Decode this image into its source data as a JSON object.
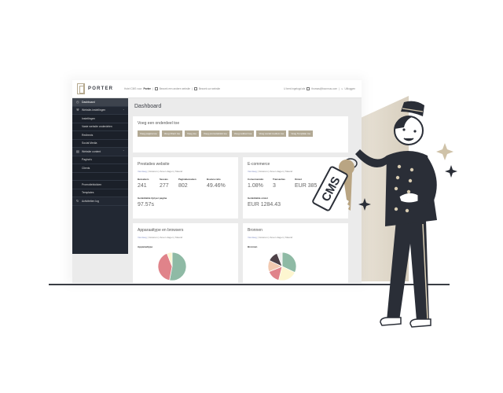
{
  "colors": {
    "accent": "#b2a994",
    "sidebar_bg": "#222833",
    "ink": "#2a2e37",
    "pie_green": "#8fbaa5",
    "pie_red": "#e0838a",
    "pie_cream": "#fdf6d0",
    "pie_dark": "#4e4148",
    "pie_peach": "#f2c9b0",
    "link_blue": "#8b96c5"
  },
  "header": {
    "logo": "PORTER",
    "intro_prefix": "Hotel CMS voor",
    "intro_brand": "Porter",
    "link_other_site": "Bezoek een andere website",
    "link_visit_site": "Bezoek uw website",
    "logged_in_as": "U bent ingelogd als",
    "user_email": "thomas@bconnus.com",
    "logout": "Uitloggen"
  },
  "sidebar": {
    "items": [
      {
        "label": "Dashboard",
        "icon": "dashboard-icon",
        "active": true
      },
      {
        "label": "Website-instellingen",
        "icon": "wrench-icon",
        "expandable": true
      },
      {
        "label": "Instellingen",
        "sub": true
      },
      {
        "label": "Vaste website onderdelen",
        "sub": true
      },
      {
        "label": "Redirects",
        "sub": true
      },
      {
        "label": "Social Media",
        "sub": true
      },
      {
        "label": "Website content",
        "icon": "content-icon",
        "expandable": true
      },
      {
        "label": "Pagina's",
        "sub": true
      },
      {
        "label": "Clients",
        "sub": true
      },
      {
        "label": "",
        "sub": true
      },
      {
        "label": "Promotieblokken",
        "sub": true
      },
      {
        "label": "Templates",
        "sub": true
      },
      {
        "label": "Activiteiten log",
        "icon": "history-icon"
      }
    ]
  },
  "dashboard": {
    "title": "Dashboard",
    "add_section": {
      "title": "Voeg een onderdeel toe",
      "buttons": [
        "Voeg pagina toe",
        "Voeg Client toe",
        "Voeg toe",
        "Voeg promotieblok toe",
        "Voeg redirect toe",
        "Voeg social medium toe",
        "Voeg Template toe"
      ]
    },
    "period_options": [
      "Vandaag",
      "Gisteren",
      "Zeven dagen",
      "Maand"
    ],
    "performance": {
      "title": "Prestaties website",
      "stats": [
        {
          "label": "Bezoekers",
          "value": "241"
        },
        {
          "label": "Sessies",
          "value": "277"
        },
        {
          "label": "Paginabezoeken",
          "value": "802"
        },
        {
          "label": "Bounce ratio",
          "value": "49.46%"
        }
      ],
      "avg_label": "Gemiddelde tijd per pagina",
      "avg_value": "97.57s"
    },
    "ecommerce": {
      "title": "E-commerce",
      "stats": [
        {
          "label": "Conversieratio",
          "value": "1.08%"
        },
        {
          "label": "Transacties",
          "value": "3"
        },
        {
          "label": "Omzet",
          "value": "EUR 385"
        }
      ],
      "avg_label": "Gemiddelde omzet",
      "avg_value": "EUR 1284.43"
    },
    "devices": {
      "title": "Apparaattype en browsers",
      "chart_label": "Apparaattype",
      "slices": [
        {
          "name": "green",
          "value": 53,
          "color": "#8fbaa5"
        },
        {
          "name": "red",
          "value": 41,
          "color": "#e0838a"
        },
        {
          "name": "cream",
          "value": 6,
          "color": "#fdf6d0"
        }
      ]
    },
    "sources": {
      "title": "Bronnen",
      "chart_label": "Bronnen",
      "slices": [
        {
          "name": "green",
          "value": 32,
          "color": "#8fbaa5"
        },
        {
          "name": "cream",
          "value": 22,
          "color": "#fdf6d0"
        },
        {
          "name": "red",
          "value": 15,
          "color": "#e0838a"
        },
        {
          "name": "peach",
          "value": 13,
          "color": "#f2c9b0"
        },
        {
          "name": "dark",
          "value": 12,
          "color": "#4e4148"
        },
        {
          "name": "white",
          "value": 6,
          "color": "#f0f0f0"
        }
      ]
    }
  },
  "illustration": {
    "tag_text": "CMS"
  }
}
